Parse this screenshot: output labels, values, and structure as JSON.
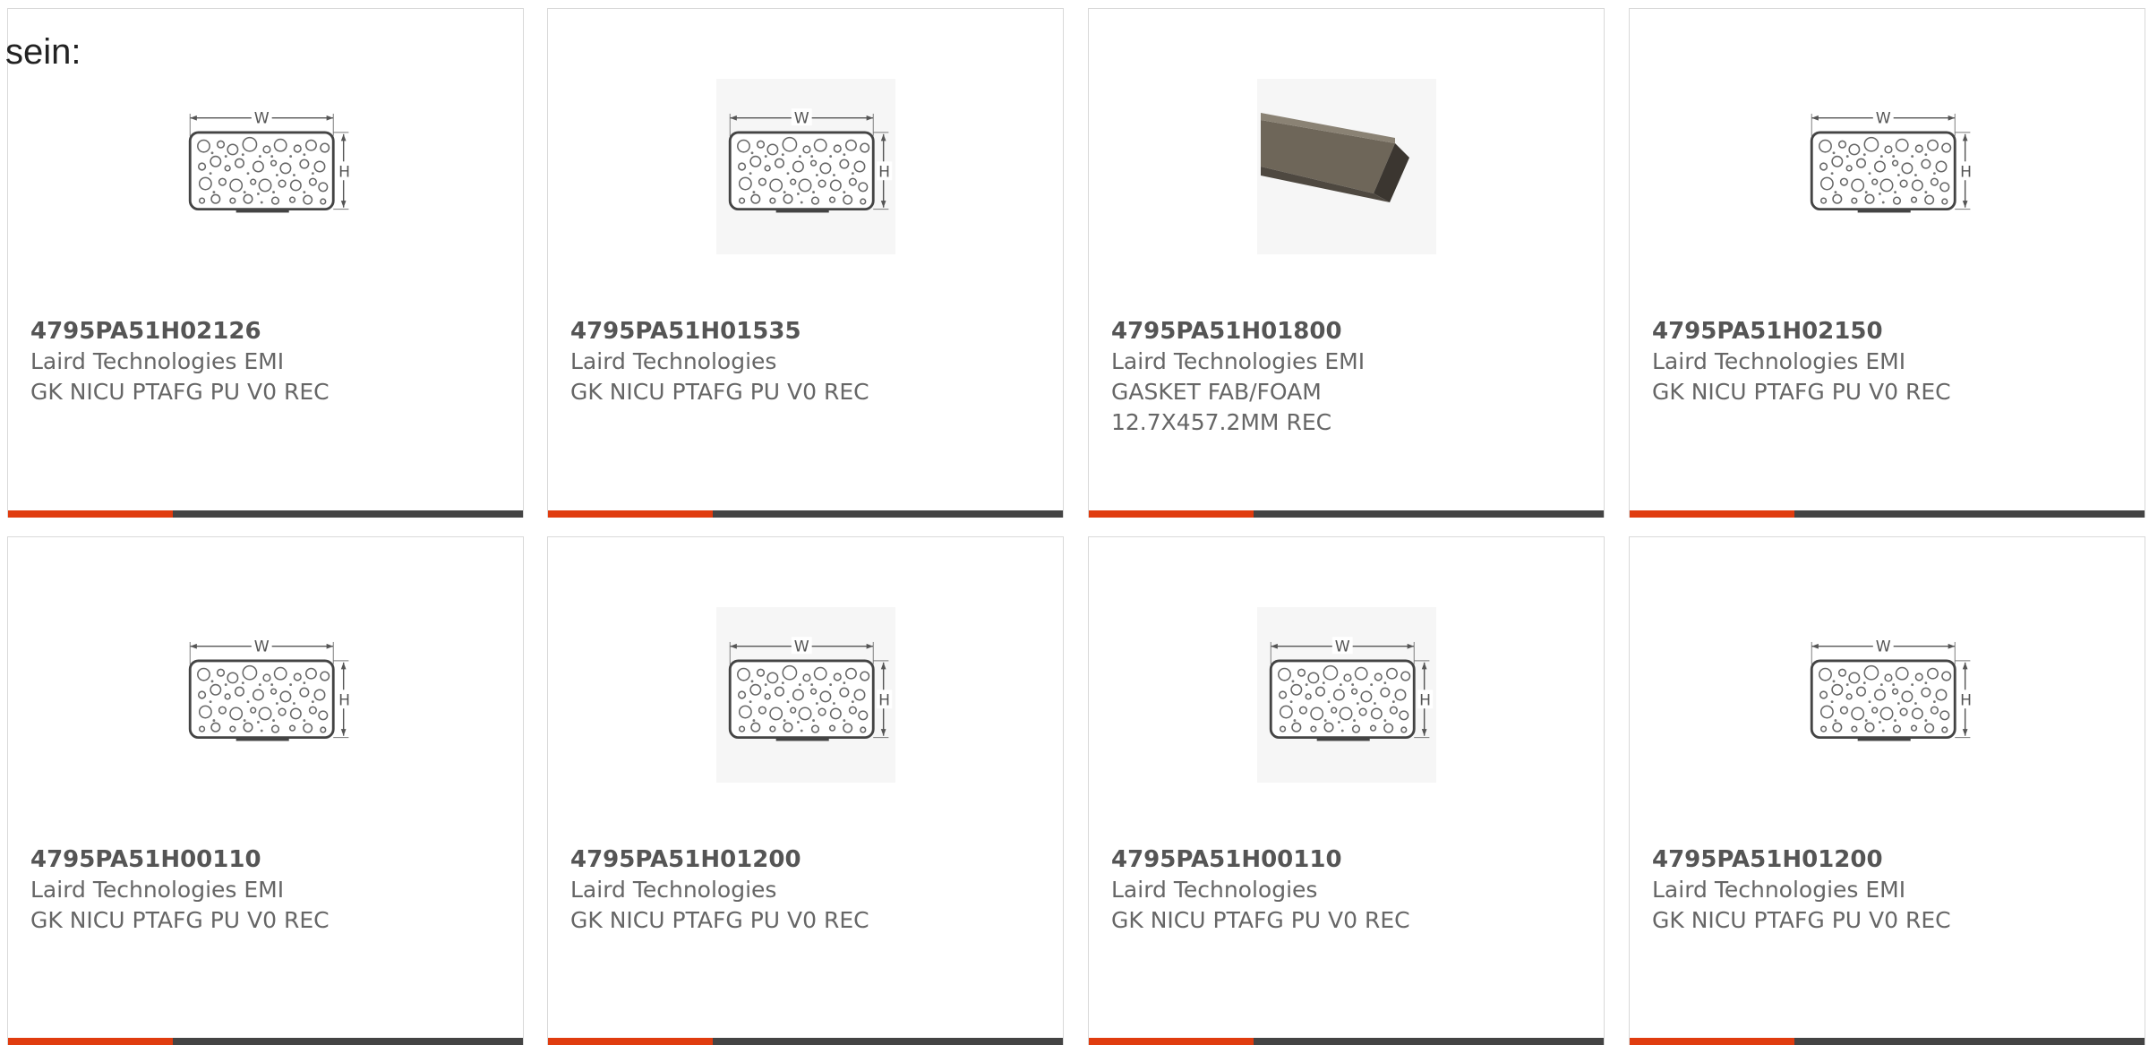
{
  "heading": "sein:",
  "colors": {
    "accent": "#e03c0f",
    "bar": "#444444",
    "border": "#d9d9d9",
    "text": "#666666"
  },
  "products": [
    {
      "part": "4795PA51H02126",
      "maker": "Laird Technologies EMI",
      "desc": "GK NICU PTAFG PU V0 REC",
      "desc2": "",
      "image": "gasket-drawing-icon"
    },
    {
      "part": "4795PA51H01535",
      "maker": "Laird Technologies",
      "desc": "GK NICU PTAFG PU V0 REC",
      "desc2": "",
      "image": "gasket-drawing-icon"
    },
    {
      "part": "4795PA51H01800",
      "maker": "Laird Technologies EMI",
      "desc": "GASKET FAB/FOAM",
      "desc2": "12.7X457.2MM REC",
      "image": "foam-strip-photo"
    },
    {
      "part": "4795PA51H02150",
      "maker": "Laird Technologies EMI",
      "desc": "GK NICU PTAFG PU V0 REC",
      "desc2": "",
      "image": "gasket-drawing-icon"
    },
    {
      "part": "4795PA51H00110",
      "maker": "Laird Technologies EMI",
      "desc": "GK NICU PTAFG PU V0 REC",
      "desc2": "",
      "image": "gasket-drawing-icon"
    },
    {
      "part": "4795PA51H01200",
      "maker": "Laird Technologies",
      "desc": "GK NICU PTAFG PU V0 REC",
      "desc2": "",
      "image": "gasket-drawing-icon"
    },
    {
      "part": "4795PA51H00110",
      "maker": "Laird Technologies",
      "desc": "GK NICU PTAFG PU V0 REC",
      "desc2": "",
      "image": "gasket-drawing-icon"
    },
    {
      "part": "4795PA51H01200",
      "maker": "Laird Technologies EMI",
      "desc": "GK NICU PTAFG PU V0 REC",
      "desc2": "",
      "image": "gasket-drawing-icon"
    }
  ]
}
